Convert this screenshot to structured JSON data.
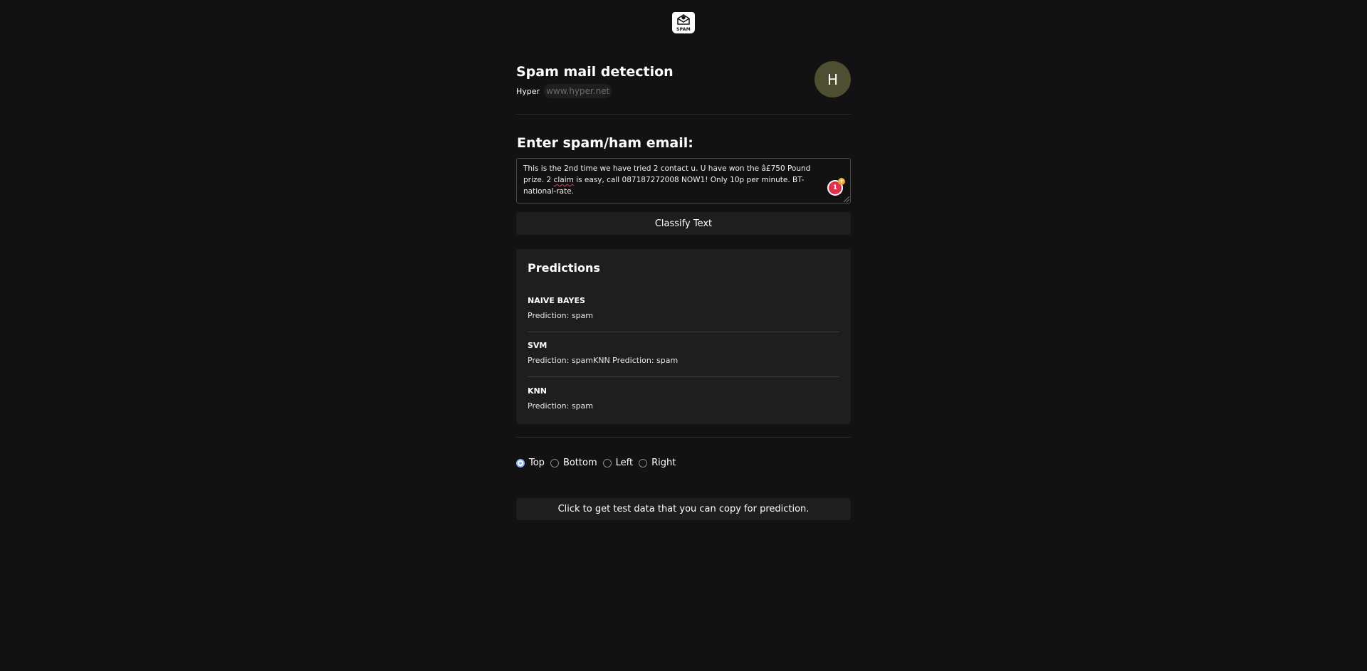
{
  "logo": {
    "text": "SPAM",
    "icon": "spam-envelope-icon"
  },
  "header": {
    "title": "Spam mail detection",
    "author": "Hyper",
    "url": "www.hyper.net",
    "avatar_initial": "H"
  },
  "input": {
    "heading": "Enter spam/ham email:",
    "text_before": "This is the 2nd time we have tried 2 contact u. U have won the â£750 Pound prize. 2 ",
    "misspelled_word": "claim",
    "text_after": " is easy, call 087187272008 NOW1! Only 10p per minute. BT-national-rate.",
    "grammar_badge_count": "1",
    "grammar_badge_plus": "+"
  },
  "classify_button": {
    "label": "Classify Text"
  },
  "predictions": {
    "title": "Predictions",
    "items": [
      {
        "model": "NAIVE BAYES",
        "result": "Prediction: spam"
      },
      {
        "model": "SVM",
        "result": "Prediction: spamKNN Prediction: spam"
      },
      {
        "model": "KNN",
        "result": "Prediction: spam"
      }
    ]
  },
  "position_options": {
    "selected": "Top",
    "options": [
      "Top",
      "Bottom",
      "Left",
      "Right"
    ]
  },
  "test_data_button": {
    "label": "Click to get test data that you can copy for prediction."
  },
  "colors": {
    "background": "#121212",
    "panel": "#1e1e1e",
    "avatar": "#4e4e32",
    "radio_accent": "#8ab4f8",
    "grammar_badge": "#e0304a"
  }
}
